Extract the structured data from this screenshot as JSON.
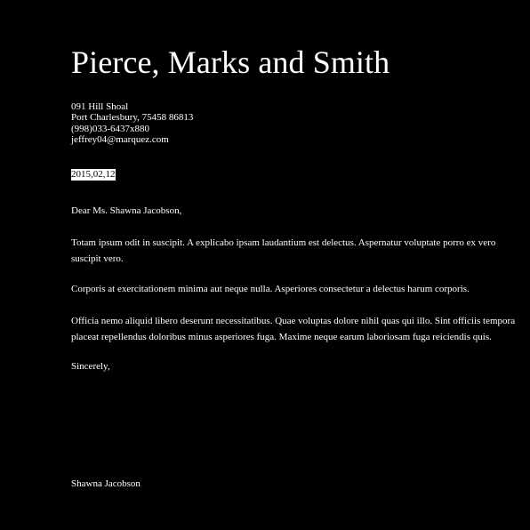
{
  "letter": {
    "company_name": "Pierce, Marks and Smith",
    "address": {
      "street": "091 Hill Shoal",
      "city_line": "Port Charlesbury, 75458 86813",
      "phone": "(998)033-6437x880",
      "email": "jeffrey04@marquez.com"
    },
    "date": "2015,02,12",
    "greeting": "Dear Ms. Shawna Jacobson,",
    "paragraphs": [
      "Totam ipsum odit in suscipit. A explicabo ipsam laudantium est delectus. Aspernatur voluptate porro ex vero suscipit vero.",
      "Corporis at exercitationem minima aut neque nulla. Asperiores consectetur a delectus harum corporis.",
      "Officia nemo aliquid libero deserunt necessitatibus. Quae voluptas dolore nihil quas qui illo. Sint officiis tempora placeat repellendus doloribus minus asperiores fuga. Maxime neque earum laboriosam fuga reiciendis quis."
    ],
    "closing": "Sincerely,",
    "signature": "Shawna Jacobson"
  },
  "colors": {
    "background": "#000000",
    "text": "#ffffff",
    "date_highlight_bg": "#ffffff",
    "date_highlight_text": "#000000"
  }
}
